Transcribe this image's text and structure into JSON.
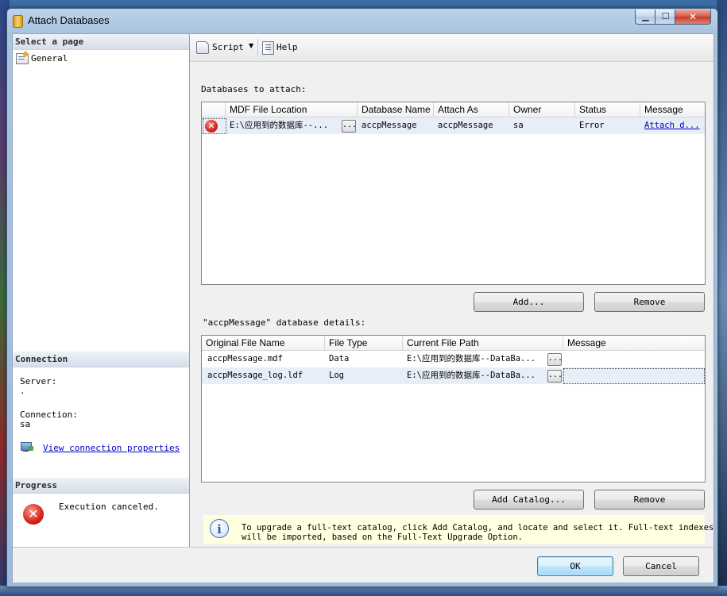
{
  "window": {
    "title": "Attach Databases",
    "minimize": "▁",
    "maximize": "☐",
    "close": "✕"
  },
  "left": {
    "select_page_header": "Select a page",
    "pages": [
      {
        "label": "General",
        "icon": "page-properties-icon"
      }
    ],
    "connection_header": "Connection",
    "server_label": "Server:",
    "server_value": ".",
    "connection_label": "Connection:",
    "connection_value": "sa",
    "view_properties_link": "View connection properties",
    "progress_header": "Progress",
    "progress_status": "Execution canceled."
  },
  "toolbar": {
    "script_label": "Script",
    "script_dropdown": "▼",
    "help_label": "Help"
  },
  "attach": {
    "label": "Databases to attach:",
    "columns": [
      "MDF File Location",
      "Database Name",
      "Attach As",
      "Owner",
      "Status",
      "Message"
    ],
    "rows": [
      {
        "mdf": "E:\\应用到的数据库--...",
        "browse": "...",
        "db_name": "accpMessage",
        "attach_as": "accpMessage",
        "owner": "sa",
        "status": "Error",
        "message": "Attach d..."
      }
    ],
    "add_button": "Add...",
    "remove_button": "Remove"
  },
  "details": {
    "label": "\"accpMessage\" database details:",
    "columns": [
      "Original File Name",
      "File Type",
      "Current File Path",
      "Message"
    ],
    "rows": [
      {
        "name": "accpMessage.mdf",
        "type": "Data",
        "path": "E:\\应用到的数据库--DataBa...",
        "browse": "...",
        "message": ""
      },
      {
        "name": "accpMessage_log.ldf",
        "type": "Log",
        "path": "E:\\应用到的数据库--DataBa...",
        "browse": "...",
        "message": ""
      }
    ],
    "add_catalog_button": "Add Catalog...",
    "remove_button": "Remove"
  },
  "info": {
    "line1": "To upgrade a full-text catalog, click Add Catalog, and locate and select it. Full-text indexes",
    "line2": "will be imported, based on the Full-Text Upgrade Option."
  },
  "footer": {
    "ok_button": "OK",
    "cancel_button": "Cancel"
  },
  "colors": {
    "header_gradient_end": "#d6deea",
    "selected_row": "#e8eef7",
    "info_bg": "#ffffe1",
    "error_red": "#d4231a",
    "link": "#0000cc"
  }
}
